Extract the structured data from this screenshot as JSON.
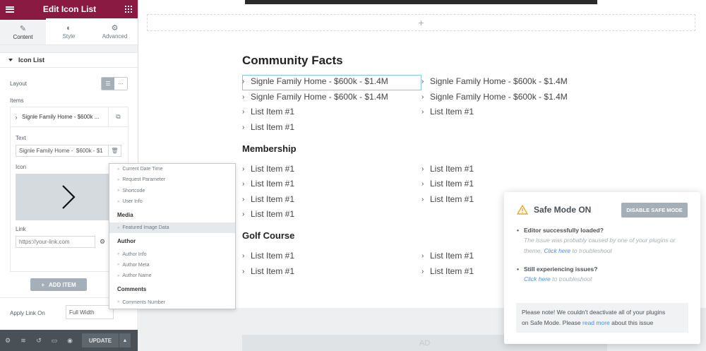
{
  "panel": {
    "title": "Edit Icon List",
    "tabs": [
      {
        "label": "Content",
        "icon": "pencil-icon"
      },
      {
        "label": "Style",
        "icon": "half-circle-icon"
      },
      {
        "label": "Advanced",
        "icon": "gear-icon"
      }
    ],
    "section": "Icon List",
    "layout_label": "Layout",
    "items_label": "Items",
    "item_title": "Signle Family Home - $600k ...",
    "text_label": "Text",
    "text_value": "Signle Family Home -  $600k - $1",
    "icon_label": "Icon",
    "link_label": "Link",
    "link_placeholder": "https://your-link.com",
    "add_item": "ADD ITEM",
    "apply_link_label": "Apply Link On",
    "apply_link_value": "Full Width",
    "update": "UPDATE"
  },
  "dynamic_menu": {
    "site_items": [
      "Current Date Time",
      "Request Parameter",
      "Shortcode",
      "User Info"
    ],
    "media_label": "Media",
    "media_items": [
      "Featured Image Data"
    ],
    "author_label": "Author",
    "author_items": [
      "Author Info",
      "Author Meta",
      "Author Name"
    ],
    "comments_label": "Comments",
    "comments_items": [
      "Comments Number"
    ]
  },
  "canvas": {
    "add_section": "+",
    "community_title": "Community Facts",
    "community_left": [
      "Signle Family Home - $600k - $1.4M",
      "Signle Family Home - $600k - $1.4M",
      "List Item #1",
      "List Item #1"
    ],
    "community_right": [
      "Signle Family Home - $600k - $1.4M",
      "Signle Family Home - $600k - $1.4M",
      "List Item #1"
    ],
    "membership_title": "Membership",
    "membership_left": [
      "List Item #1",
      "List Item #1",
      "List Item #1",
      "List Item #1"
    ],
    "membership_right": [
      "List Item #1",
      "List Item #1",
      "List Item #1"
    ],
    "golf_title": "Golf Course",
    "golf_left": [
      "List Item #1",
      "List Item #1"
    ],
    "golf_right": [
      "List Item #1",
      "List Item #1"
    ],
    "bottom_text": "AD"
  },
  "safe_mode": {
    "title": "Safe Mode ON",
    "disable_button": "DISABLE SAFE MODE",
    "bullet1_head": "Editor successfully loaded?",
    "bullet1_sub_a": "The issue was probably caused by one of your plugins or",
    "bullet1_sub_b": "theme.",
    "bullet1_link": "Click here",
    "bullet1_tail": "to troubleshoot",
    "bullet2_head": "Still experiencing issues?",
    "bullet2_link": "Click here",
    "bullet2_tail": "to troubleshoot",
    "note_a": "Please note! We couldn't deactivate all of your plugins",
    "note_b": "on Safe Mode. Please",
    "note_link": "read more",
    "note_tail": "about this issue"
  },
  "colors": {
    "brand": "#8b1a43",
    "accent_link": "#4a90e2",
    "warning": "#f0a92c"
  }
}
